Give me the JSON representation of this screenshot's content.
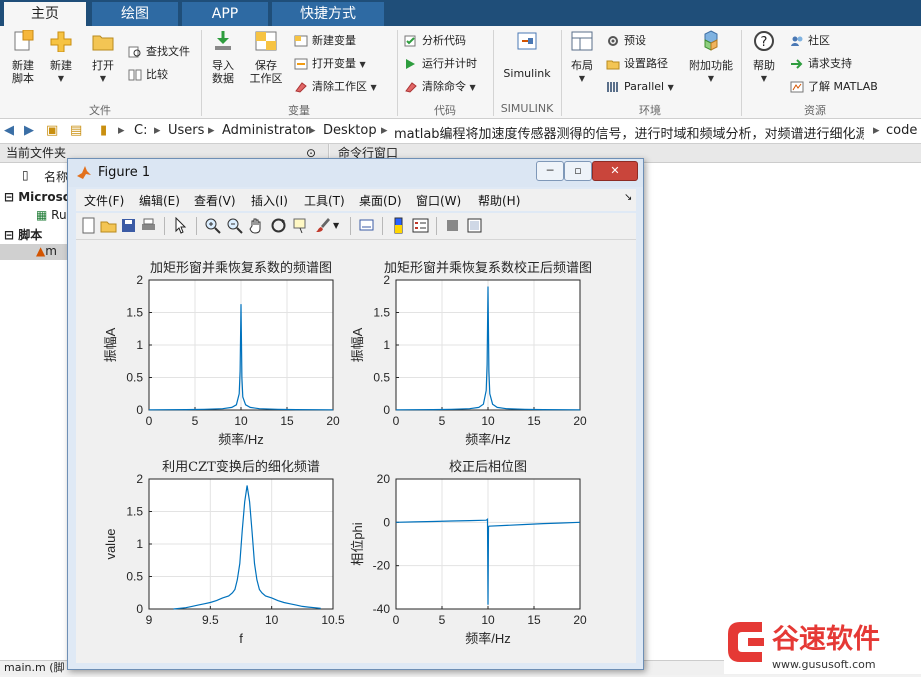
{
  "ribbon_tabs": [
    "主页",
    "绘图",
    "APP",
    "快捷方式"
  ],
  "ribbon": {
    "file": {
      "new_script": "新建\n脚本",
      "new": "新建",
      "open": "打开",
      "find_files": "查找文件",
      "compare": "比较",
      "label": "文件"
    },
    "variable": {
      "import_data": "导入\n数据",
      "save_workspace": "保存\n工作区",
      "new_variable": "新建变量",
      "open_variable": "打开变量",
      "clear_workspace": "清除工作区",
      "label": "变量"
    },
    "code": {
      "analyze_code": "分析代码",
      "run_and_time": "运行并计时",
      "clear_commands": "清除命令",
      "label": "代码"
    },
    "simulink": {
      "simulink": "Simulink",
      "label": "SIMULINK"
    },
    "environment": {
      "layout": "布局",
      "preferences": "预设",
      "set_path": "设置路径",
      "parallel": "Parallel",
      "add_ons": "附加功能",
      "label": "环境"
    },
    "resources": {
      "help": "帮助",
      "community": "社区",
      "request_support": "请求支持",
      "learn_matlab": "了解 MATLAB",
      "label": "资源"
    }
  },
  "address_path": [
    "C:",
    "Users",
    "Administrator",
    "Desktop",
    "matlab编程将加速度传感器测得的信号，进行时域和频域分析，对频谱进行细化源码程序",
    "code"
  ],
  "left_panel": {
    "header": "当前文件夹",
    "col_name": "名称",
    "items": [
      "Microso",
      "Ru",
      "脚本",
      "m"
    ]
  },
  "right_panel": {
    "header": "命令行窗口"
  },
  "status_text": "main.m  (脚",
  "figure": {
    "title": "Figure 1",
    "menus": [
      "文件(F)",
      "编辑(E)",
      "查看(V)",
      "插入(I)",
      "工具(T)",
      "桌面(D)",
      "窗口(W)",
      "帮助(H)"
    ],
    "window_buttons": [
      "minimize",
      "maximize",
      "close"
    ]
  },
  "chart_data": [
    {
      "type": "line",
      "title": "加矩形窗并乘恢复系数的频谱图",
      "xlabel": "频率/Hz",
      "ylabel": "振幅A",
      "xlim": [
        0,
        20
      ],
      "ylim": [
        0,
        2
      ],
      "xticks": [
        0,
        5,
        10,
        15,
        20
      ],
      "yticks": [
        0,
        0.5,
        1,
        1.5,
        2
      ],
      "grid": true,
      "color": "#0072BD",
      "x": [
        0,
        2,
        4,
        6,
        8,
        9,
        9.5,
        9.8,
        9.9,
        10.0,
        10.1,
        10.2,
        10.5,
        11,
        12,
        14,
        16,
        18,
        20
      ],
      "y": [
        0.003,
        0.004,
        0.006,
        0.01,
        0.02,
        0.04,
        0.08,
        0.25,
        0.6,
        1.63,
        0.5,
        0.2,
        0.08,
        0.04,
        0.02,
        0.01,
        0.006,
        0.004,
        0.003
      ]
    },
    {
      "type": "line",
      "title": "加矩形窗并乘恢复系数校正后频谱图",
      "xlabel": "频率/Hz",
      "ylabel": "振幅A",
      "xlim": [
        0,
        20
      ],
      "ylim": [
        0,
        2
      ],
      "xticks": [
        0,
        5,
        10,
        15,
        20
      ],
      "yticks": [
        0,
        0.5,
        1,
        1.5,
        2
      ],
      "grid": true,
      "color": "#0072BD",
      "x": [
        0,
        2,
        4,
        6,
        8,
        9,
        9.5,
        9.8,
        9.9,
        10.0,
        10.1,
        10.2,
        10.5,
        11,
        12,
        14,
        16,
        18,
        20
      ],
      "y": [
        0.003,
        0.004,
        0.006,
        0.01,
        0.02,
        0.04,
        0.09,
        0.3,
        0.7,
        1.9,
        0.6,
        0.25,
        0.09,
        0.04,
        0.02,
        0.01,
        0.006,
        0.004,
        0.003
      ]
    },
    {
      "type": "line",
      "title": "利用CZT变换后的细化频谱",
      "xlabel": "f",
      "ylabel": "value",
      "xlim": [
        9,
        10.5
      ],
      "ylim": [
        0,
        2
      ],
      "xticks": [
        9,
        9.5,
        10,
        10.5
      ],
      "yticks": [
        0,
        0.5,
        1,
        1.5,
        2
      ],
      "grid": true,
      "color": "#0072BD",
      "x": [
        9.2,
        9.3,
        9.35,
        9.4,
        9.45,
        9.5,
        9.55,
        9.6,
        9.65,
        9.68,
        9.7,
        9.72,
        9.74,
        9.76,
        9.78,
        9.8,
        9.82,
        9.84,
        9.86,
        9.88,
        9.9,
        9.92,
        9.95,
        10.0,
        10.05,
        10.1,
        10.15,
        10.2,
        10.25,
        10.3,
        10.35,
        10.4
      ],
      "y": [
        0.0,
        0.02,
        0.04,
        0.06,
        0.08,
        0.1,
        0.13,
        0.17,
        0.2,
        0.25,
        0.3,
        0.45,
        0.7,
        1.2,
        1.65,
        1.9,
        1.65,
        1.2,
        0.7,
        0.45,
        0.3,
        0.25,
        0.2,
        0.17,
        0.13,
        0.1,
        0.08,
        0.06,
        0.04,
        0.03,
        0.02,
        0.01
      ]
    },
    {
      "type": "line",
      "title": "校正后相位图",
      "xlabel": "频率/Hz",
      "ylabel": "相位phi",
      "xlim": [
        0,
        20
      ],
      "ylim": [
        -40,
        20
      ],
      "xticks": [
        0,
        5,
        10,
        15,
        20
      ],
      "yticks": [
        -40,
        -20,
        0,
        20
      ],
      "grid": true,
      "color": "#0072BD",
      "x": [
        0,
        2,
        4,
        6,
        8,
        9.8,
        9.9,
        9.95,
        10.0,
        10.05,
        10.1,
        12,
        14,
        16,
        18,
        20
      ],
      "y": [
        0,
        0.2,
        0.4,
        0.6,
        0.8,
        1.0,
        1.2,
        1.4,
        -38,
        -2.0,
        -1.8,
        -1.4,
        -1.0,
        -0.6,
        -0.3,
        0
      ]
    }
  ],
  "watermark": {
    "text": "谷速软件",
    "url": "www.gususoft.com",
    "color": "#e53935"
  }
}
